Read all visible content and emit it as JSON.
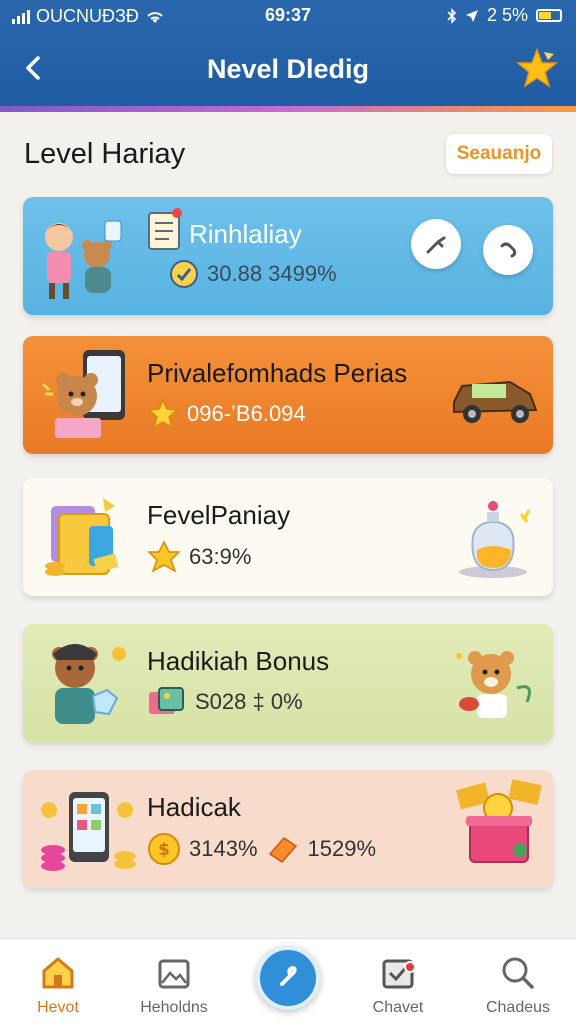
{
  "status_bar": {
    "carrier": "OUCNUĐЗĐ",
    "time": "69:37",
    "battery": "2 5%"
  },
  "nav": {
    "title": "Nevel Dledig"
  },
  "section": {
    "heading": "Level Hariay",
    "season_button": "Seauanjo"
  },
  "cards": [
    {
      "title": "Rinhlaliay",
      "stat": "30.88 3499%"
    },
    {
      "title": "Privalefomhads Perias",
      "stat": "096-’B6.094"
    },
    {
      "title": "FevelPaniay",
      "stat": "63:9%"
    },
    {
      "title": "Hadikiah Bonus",
      "stat": "S028 ‡ 0%"
    },
    {
      "title": "Hadicak",
      "stat": "3143%",
      "stat2": "1529%"
    }
  ],
  "bottom_nav": {
    "items": [
      {
        "label": "Hevot",
        "icon": "home-icon"
      },
      {
        "label": "Heholdns",
        "icon": "image-icon"
      },
      {
        "label": "Chavet",
        "icon": "checkbox-icon"
      },
      {
        "label": "Chadeus",
        "icon": "search-icon"
      }
    ]
  },
  "colors": {
    "header": "#1f5ca3",
    "card_blue": "#58b2e0",
    "card_orange": "#ea7a25",
    "card_cream": "#fdfbf1",
    "card_green": "#d6e3a6",
    "card_peach": "#f8dccb",
    "accent_active": "#d27a1a",
    "fab": "#2f8fd8"
  }
}
